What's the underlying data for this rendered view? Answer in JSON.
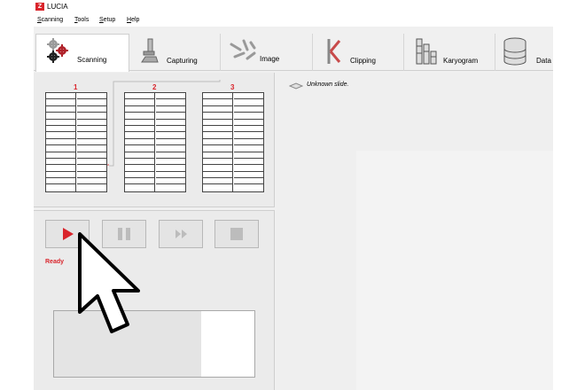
{
  "app": {
    "title": "LUCIA",
    "logo_letter": "Z"
  },
  "menu": [
    {
      "label": "Scanning",
      "accel": "S",
      "rest": "canning"
    },
    {
      "label": "Tools",
      "accel": "T",
      "rest": "ools"
    },
    {
      "label": "Setup",
      "accel": "S",
      "rest": "etup"
    },
    {
      "label": "Help",
      "accel": "H",
      "rest": "elp"
    }
  ],
  "tabs": [
    {
      "label": "Scanning",
      "icon": "gears-icon",
      "active": true
    },
    {
      "label": "Capturing",
      "icon": "microscope-icon",
      "active": false
    },
    {
      "label": "Image",
      "icon": "chromosomes-icon",
      "active": false
    },
    {
      "label": "Clipping",
      "icon": "clipping-icon",
      "active": false
    },
    {
      "label": "Karyogram",
      "icon": "karyogram-icon",
      "active": false
    },
    {
      "label": "Data",
      "icon": "database-icon",
      "active": false
    }
  ],
  "slide_holders": [
    {
      "number": "1"
    },
    {
      "number": "2"
    },
    {
      "number": "3"
    }
  ],
  "slide_status": "Unknown slide.",
  "controls": [
    {
      "name": "play-button",
      "icon": "play-icon"
    },
    {
      "name": "pause-button",
      "icon": "pause-icon"
    },
    {
      "name": "fast-forward-button",
      "icon": "fast-forward-icon"
    },
    {
      "name": "stop-button",
      "icon": "stop-icon"
    }
  ],
  "scan_status": "Ready",
  "colors": {
    "accent": "#d9242b",
    "panel": "#ebebeb",
    "window": "#f0f0f0"
  }
}
